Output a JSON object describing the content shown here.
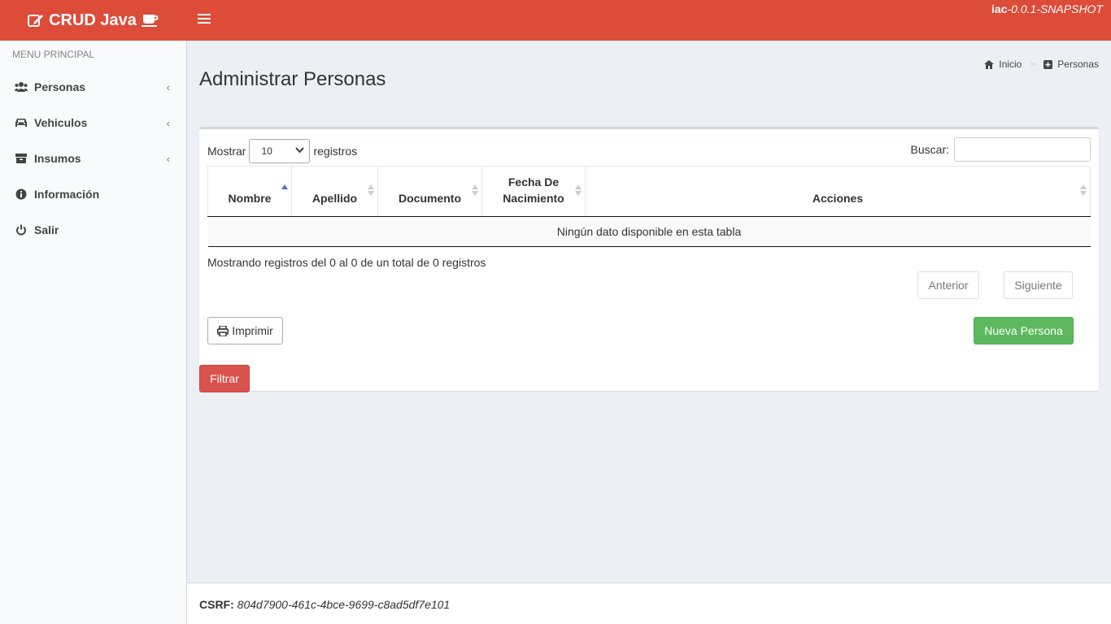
{
  "app": {
    "logo_text": "CRUD Java",
    "version_bold": "iac",
    "version_italic": "-0.0.1-SNAPSHOT"
  },
  "colors": {
    "header": "#dd4b39",
    "success": "#5cb85c",
    "danger": "#d9534f"
  },
  "sidebar": {
    "header": "MENU PRINCIPAL",
    "items": [
      {
        "label": "Personas",
        "icon": "users-icon",
        "has_submenu": true
      },
      {
        "label": "Vehiculos",
        "icon": "car-icon",
        "has_submenu": true
      },
      {
        "label": "Insumos",
        "icon": "archive-icon",
        "has_submenu": true
      },
      {
        "label": "Información",
        "icon": "info-icon",
        "has_submenu": false
      },
      {
        "label": "Salir",
        "icon": "power-icon",
        "has_submenu": false
      }
    ]
  },
  "page": {
    "title": "Administrar Personas"
  },
  "breadcrumb": {
    "home": "Inicio",
    "current": "Personas"
  },
  "table_controls": {
    "show_label": "Mostrar",
    "page_size": "10",
    "records_label": "registros",
    "search_label": "Buscar:",
    "search_value": ""
  },
  "table": {
    "columns": [
      "Nombre",
      "Apellido",
      "Documento",
      "Fecha De Nacimiento",
      "Acciones"
    ],
    "sorted_column": "Nombre",
    "empty_message": "Ningún dato disponible en esta tabla"
  },
  "pagination": {
    "info": "Mostrando registros del 0 al 0 de un total de 0 registros",
    "prev": "Anterior",
    "next": "Siguiente"
  },
  "actions": {
    "print": "Imprimir",
    "new_person": "Nueva Persona",
    "filter": "Filtrar"
  },
  "footer": {
    "csrf_label": "CSRF:",
    "csrf_token": "804d7900-461c-4bce-9699-c8ad5df7e101"
  }
}
